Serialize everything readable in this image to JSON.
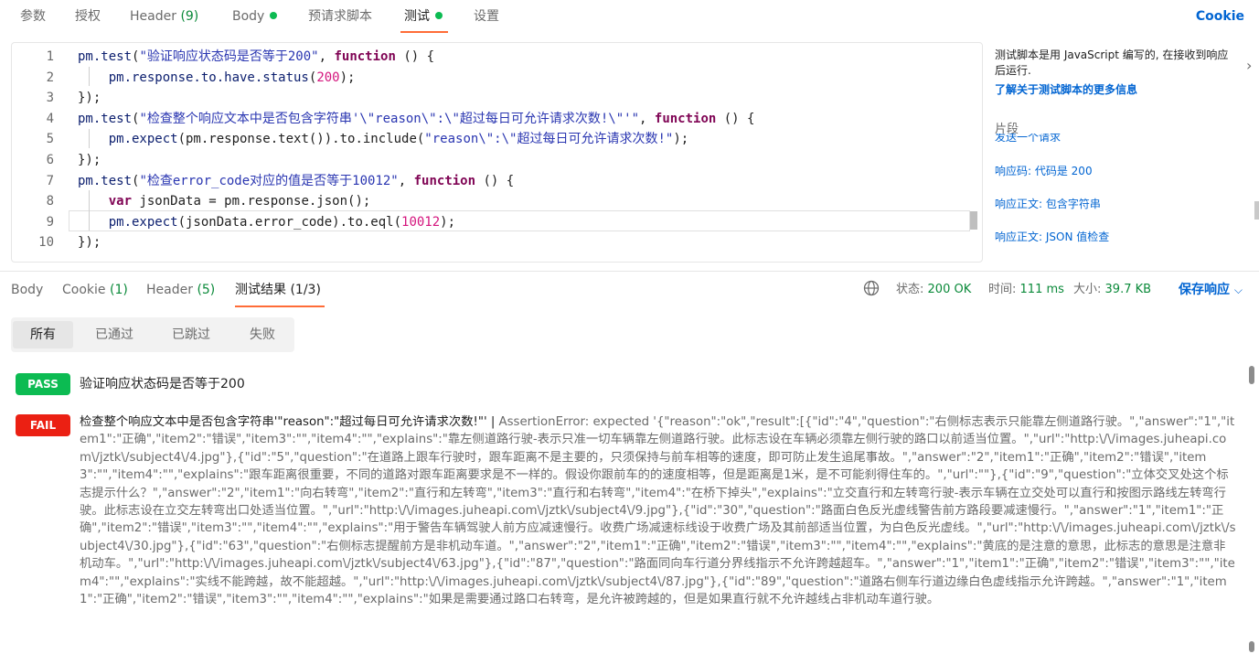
{
  "request_tabs": [
    {
      "label": "参数"
    },
    {
      "label": "授权"
    },
    {
      "label": "Header",
      "count": "(9)"
    },
    {
      "label": "Body",
      "dot": true
    },
    {
      "label": "预请求脚本"
    },
    {
      "label": "测试",
      "dot": true,
      "active": true
    },
    {
      "label": "设置"
    }
  ],
  "cookie_link": "Cookie",
  "editor": {
    "lines": [
      {
        "num": "1",
        "segments": [
          [
            "obj",
            "pm.test"
          ],
          [
            "p",
            "("
          ],
          [
            "str",
            "\"验证响应状态码是否等于200\""
          ],
          [
            "p",
            ", "
          ],
          [
            "kw",
            "function"
          ],
          [
            "p",
            " () {"
          ]
        ]
      },
      {
        "num": "2",
        "segments": [
          [
            "p",
            "    "
          ],
          [
            "obj",
            "pm.response.to.have.status"
          ],
          [
            "p",
            "("
          ],
          [
            "num",
            "200"
          ],
          [
            "p",
            ");"
          ]
        ]
      },
      {
        "num": "3",
        "segments": [
          [
            "p",
            "});"
          ]
        ]
      },
      {
        "num": "4",
        "segments": [
          [
            "obj",
            "pm.test"
          ],
          [
            "p",
            "("
          ],
          [
            "str",
            "\"检查整个响应文本中是否包含字符串'\\\"reason\\\":\\\"超过每日可允许请求次数!\\\"'\""
          ],
          [
            "p",
            ", "
          ],
          [
            "kw",
            "function"
          ],
          [
            "p",
            " () {"
          ]
        ]
      },
      {
        "num": "5",
        "segments": [
          [
            "p",
            "    "
          ],
          [
            "obj",
            "pm.expect"
          ],
          [
            "p",
            "(pm.response.text()).to.include("
          ],
          [
            "str",
            "\"reason\\\":\\\"超过每日可允许请求次数!\""
          ],
          [
            "p",
            ");"
          ]
        ]
      },
      {
        "num": "6",
        "segments": [
          [
            "p",
            "});"
          ]
        ]
      },
      {
        "num": "7",
        "segments": [
          [
            "obj",
            "pm.test"
          ],
          [
            "p",
            "("
          ],
          [
            "str",
            "\"检查error_code对应的值是否等于10012\""
          ],
          [
            "p",
            ", "
          ],
          [
            "kw",
            "function"
          ],
          [
            "p",
            " () {"
          ]
        ]
      },
      {
        "num": "8",
        "segments": [
          [
            "p",
            "    "
          ],
          [
            "kw",
            "var"
          ],
          [
            "p",
            " jsonData = pm.response.json();"
          ]
        ]
      },
      {
        "num": "9",
        "segments": [
          [
            "p",
            "    "
          ],
          [
            "obj",
            "pm.expect"
          ],
          [
            "p",
            "(jsonData.error_code).to.eql("
          ],
          [
            "num",
            "10012"
          ],
          [
            "p",
            ");"
          ]
        ]
      },
      {
        "num": "10",
        "segments": [
          [
            "p",
            "});"
          ]
        ]
      }
    ]
  },
  "side_panel": {
    "description": "测试脚本是用 JavaScript 编写的, 在接收到响应后运行.",
    "learn_more": "了解关于测试脚本的更多信息",
    "snippets_title": "片段",
    "snippet_cut": "发送一个请求",
    "snippets": [
      "响应码: 代码是 200",
      "响应正文: 包含字符串",
      "响应正文: JSON 值检查"
    ]
  },
  "response_tabs": [
    {
      "label": "Body"
    },
    {
      "label": "Cookie",
      "count": "(1)"
    },
    {
      "label": "Header",
      "count": "(5)"
    },
    {
      "label": "测试结果 (1/3)",
      "active": true
    }
  ],
  "response_meta": {
    "status_label": "状态:",
    "status_value": "200 OK",
    "time_label": "时间:",
    "time_value": "111 ms",
    "size_label": "大小:",
    "size_value": "39.7 KB",
    "save_label": "保存响应"
  },
  "filters": [
    {
      "label": "所有",
      "active": true
    },
    {
      "label": "已通过"
    },
    {
      "label": "已跳过"
    },
    {
      "label": "失败"
    }
  ],
  "results": [
    {
      "status": "PASS",
      "name": "验证响应状态码是否等于200"
    },
    {
      "status": "FAIL",
      "name": "检查整个响应文本中是否包含字符串'\"reason\":\"超过每日可允许请求次数!\"' | ",
      "error": "AssertionError: expected '{\"reason\":\"ok\",\"result\":[{\"id\":\"4\",\"question\":\"右侧标志表示只能靠左侧道路行驶。\",\"answer\":\"1\",\"item1\":\"正确\",\"item2\":\"错误\",\"item3\":\"\",\"item4\":\"\",\"explains\":\"靠左侧道路行驶-表示只准一切车辆靠左侧道路行驶。此标志设在车辆必须靠左侧行驶的路口以前适当位置。\",\"url\":\"http:\\/\\/images.juheapi.com\\/jztk\\/subject4\\/4.jpg\"},{\"id\":\"5\",\"question\":\"在道路上跟车行驶时，跟车距离不是主要的，只须保持与前车相等的速度，即可防止发生追尾事故。\",\"answer\":\"2\",\"item1\":\"正确\",\"item2\":\"错误\",\"item3\":\"\",\"item4\":\"\",\"explains\":\"跟车距离很重要，不同的道路对跟车距离要求是不一样的。假设你跟前车的的速度相等，但是距离是1米，是不可能刹得住车的。\",\"url\":\"\"},{\"id\":\"9\",\"question\":\"立体交叉处这个标志提示什么？\",\"answer\":\"2\",\"item1\":\"向右转弯\",\"item2\":\"直行和左转弯\",\"item3\":\"直行和右转弯\",\"item4\":\"在桥下掉头\",\"explains\":\"立交直行和左转弯行驶-表示车辆在立交处可以直行和按图示路线左转弯行驶。此标志设在立交左转弯出口处适当位置。\",\"url\":\"http:\\/\\/images.juheapi.com\\/jztk\\/subject4\\/9.jpg\"},{\"id\":\"30\",\"question\":\"路面白色反光虚线警告前方路段要减速慢行。\",\"answer\":\"1\",\"item1\":\"正确\",\"item2\":\"错误\",\"item3\":\"\",\"item4\":\"\",\"explains\":\"用于警告车辆驾驶人前方应减速慢行。收费广场减速标线设于收费广场及其前部适当位置，为白色反光虚线。\",\"url\":\"http:\\/\\/images.juheapi.com\\/jztk\\/subject4\\/30.jpg\"},{\"id\":\"63\",\"question\":\"右侧标志提醒前方是非机动车道。\",\"answer\":\"2\",\"item1\":\"正确\",\"item2\":\"错误\",\"item3\":\"\",\"item4\":\"\",\"explains\":\"黄底的是注意的意思，此标志的意思是注意非机动车。\",\"url\":\"http:\\/\\/images.juheapi.com\\/jztk\\/subject4\\/63.jpg\"},{\"id\":\"87\",\"question\":\"路面同向车行道分界线指示不允许跨越超车。\",\"answer\":\"1\",\"item1\":\"正确\",\"item2\":\"错误\",\"item3\":\"\",\"item4\":\"\",\"explains\":\"实线不能跨越，故不能超越。\",\"url\":\"http:\\/\\/images.juheapi.com\\/jztk\\/subject4\\/87.jpg\"},{\"id\":\"89\",\"question\":\"道路右侧车行道边缘白色虚线指示允许跨越。\",\"answer\":\"1\",\"item1\":\"正确\",\"item2\":\"错误\",\"item3\":\"\",\"item4\":\"\",\"explains\":\"如果是需要通过路口右转弯，是允许被跨越的，但是如果直行就不允许越线占非机动车道行驶。"
    }
  ]
}
